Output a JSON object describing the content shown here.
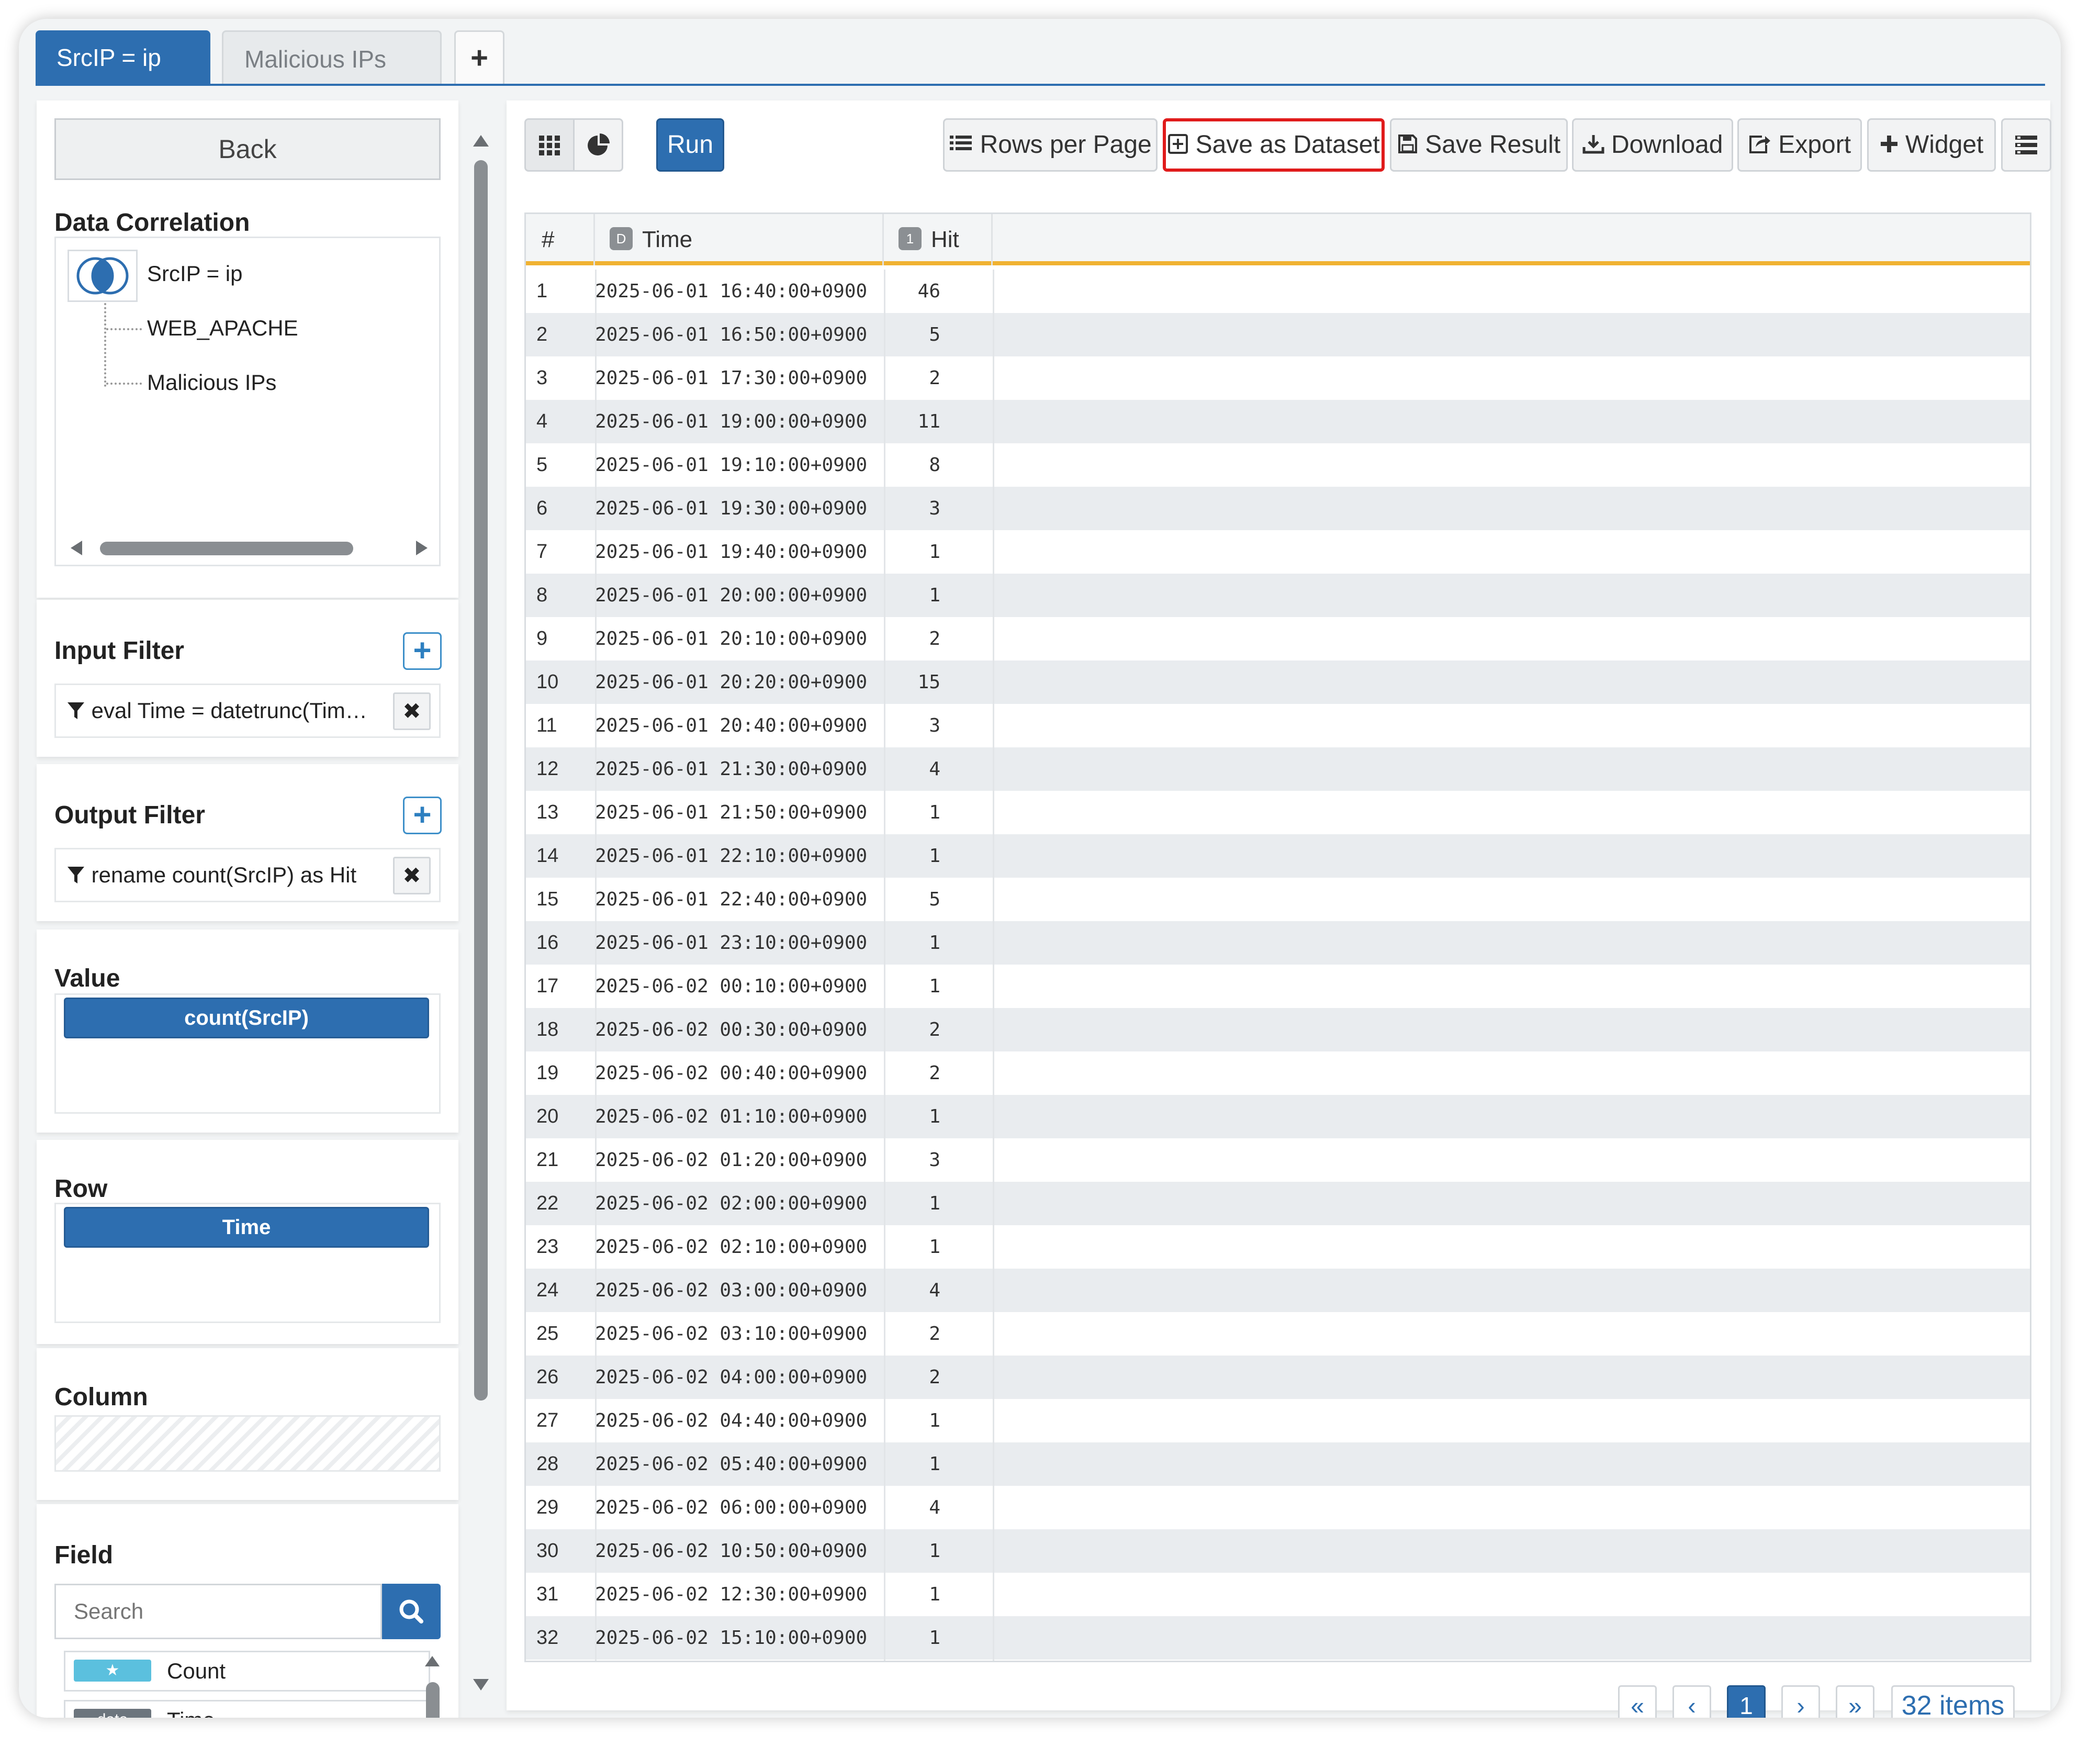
{
  "tabs": {
    "active": "SrcIP = ip",
    "inactive": "Malicious IPs",
    "add": "+"
  },
  "sidebar": {
    "back_label": "Back",
    "correlation": {
      "title": "Data Correlation",
      "root": "SrcIP = ip",
      "children": [
        "WEB_APACHE",
        "Malicious IPs"
      ]
    },
    "input_filter": {
      "title": "Input Filter",
      "add": "+",
      "remove": "✖",
      "items": [
        "eval Time = datetrunc(Tim…"
      ]
    },
    "output_filter": {
      "title": "Output Filter",
      "add": "+",
      "remove": "✖",
      "items": [
        "rename count(SrcIP) as Hit"
      ]
    },
    "value": {
      "title": "Value",
      "pills": [
        "count(SrcIP)"
      ]
    },
    "row": {
      "title": "Row",
      "pills": [
        "Time"
      ]
    },
    "column": {
      "title": "Column"
    },
    "field": {
      "title": "Field",
      "search_placeholder": "Search",
      "items": [
        {
          "type": "★",
          "name": "Count",
          "color": "#5bc0de"
        },
        {
          "type": "date",
          "name": "Time",
          "color": "#6c757d"
        }
      ]
    }
  },
  "toolbar": {
    "run": "Run",
    "rows_per_page": "Rows per Page",
    "save_dataset": "Save as Dataset",
    "save_result": "Save Result",
    "download": "Download",
    "export": "Export",
    "widget": "Widget"
  },
  "grid": {
    "headers": {
      "idx": "#",
      "time": "Time",
      "time_badge": "D",
      "hit": "Hit",
      "hit_badge": "1"
    },
    "rows": [
      [
        "1",
        "2025-06-01 16:40:00+0900",
        "46"
      ],
      [
        "2",
        "2025-06-01 16:50:00+0900",
        "5"
      ],
      [
        "3",
        "2025-06-01 17:30:00+0900",
        "2"
      ],
      [
        "4",
        "2025-06-01 19:00:00+0900",
        "11"
      ],
      [
        "5",
        "2025-06-01 19:10:00+0900",
        "8"
      ],
      [
        "6",
        "2025-06-01 19:30:00+0900",
        "3"
      ],
      [
        "7",
        "2025-06-01 19:40:00+0900",
        "1"
      ],
      [
        "8",
        "2025-06-01 20:00:00+0900",
        "1"
      ],
      [
        "9",
        "2025-06-01 20:10:00+0900",
        "2"
      ],
      [
        "10",
        "2025-06-01 20:20:00+0900",
        "15"
      ],
      [
        "11",
        "2025-06-01 20:40:00+0900",
        "3"
      ],
      [
        "12",
        "2025-06-01 21:30:00+0900",
        "4"
      ],
      [
        "13",
        "2025-06-01 21:50:00+0900",
        "1"
      ],
      [
        "14",
        "2025-06-01 22:10:00+0900",
        "1"
      ],
      [
        "15",
        "2025-06-01 22:40:00+0900",
        "5"
      ],
      [
        "16",
        "2025-06-01 23:10:00+0900",
        "1"
      ],
      [
        "17",
        "2025-06-02 00:10:00+0900",
        "1"
      ],
      [
        "18",
        "2025-06-02 00:30:00+0900",
        "2"
      ],
      [
        "19",
        "2025-06-02 00:40:00+0900",
        "2"
      ],
      [
        "20",
        "2025-06-02 01:10:00+0900",
        "1"
      ],
      [
        "21",
        "2025-06-02 01:20:00+0900",
        "3"
      ],
      [
        "22",
        "2025-06-02 02:00:00+0900",
        "1"
      ],
      [
        "23",
        "2025-06-02 02:10:00+0900",
        "1"
      ],
      [
        "24",
        "2025-06-02 03:00:00+0900",
        "4"
      ],
      [
        "25",
        "2025-06-02 03:10:00+0900",
        "2"
      ],
      [
        "26",
        "2025-06-02 04:00:00+0900",
        "2"
      ],
      [
        "27",
        "2025-06-02 04:40:00+0900",
        "1"
      ],
      [
        "28",
        "2025-06-02 05:40:00+0900",
        "1"
      ],
      [
        "29",
        "2025-06-02 06:00:00+0900",
        "4"
      ],
      [
        "30",
        "2025-06-02 10:50:00+0900",
        "1"
      ],
      [
        "31",
        "2025-06-02 12:30:00+0900",
        "1"
      ],
      [
        "32",
        "2025-06-02 15:10:00+0900",
        "1"
      ]
    ]
  },
  "pagination": {
    "first": "«",
    "prev": "‹",
    "current": "1",
    "next": "›",
    "last": "»",
    "total": "32 items"
  },
  "colors": {
    "accent": "#2d6eb0",
    "highlight": "#e01b1b",
    "header_border": "#f0b232"
  }
}
